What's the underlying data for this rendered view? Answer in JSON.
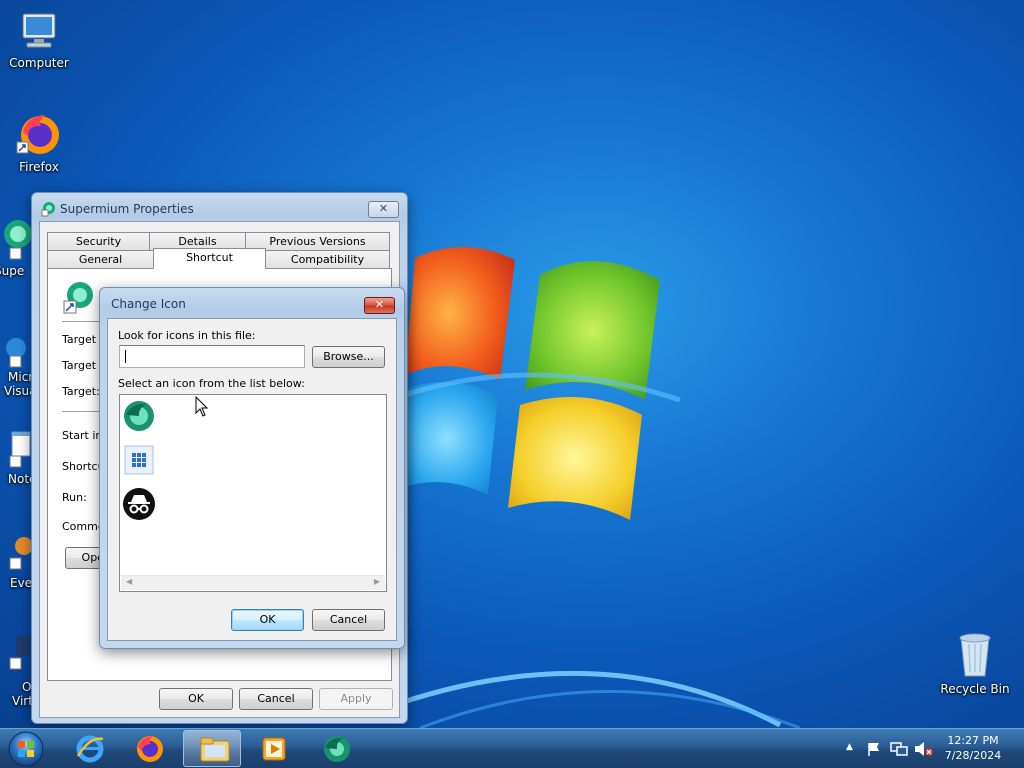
{
  "desktop": {
    "icons": [
      {
        "label": "Computer"
      },
      {
        "label": "Firefox"
      },
      {
        "label": "Supe"
      },
      {
        "label": "Micr"
      },
      {
        "label": "Visua"
      },
      {
        "label": "Note"
      },
      {
        "label": "Eve"
      },
      {
        "label": "O"
      },
      {
        "label": "Virt"
      },
      {
        "label": "Recycle Bin"
      }
    ]
  },
  "properties_window": {
    "title": "Supermium Properties",
    "tabs_top": [
      "Security",
      "Details",
      "Previous Versions"
    ],
    "tabs_bottom": [
      "General",
      "Shortcut",
      "Compatibility"
    ],
    "active_tab": "Shortcut",
    "fields": [
      "Target ty",
      "Target lo",
      "Target:",
      "Start in:",
      "Shortcut",
      "Run:",
      "Commen"
    ],
    "open_button": "Oper",
    "buttons": {
      "ok": "OK",
      "cancel": "Cancel",
      "apply": "Apply"
    }
  },
  "change_icon_dialog": {
    "title": "Change Icon",
    "look_for_label": "Look for icons in this file:",
    "file_value": "",
    "browse_button": "Browse...",
    "select_label": "Select an icon from the list below:",
    "icons": [
      "supermium-icon",
      "app-grid-icon",
      "incognito-icon"
    ],
    "buttons": {
      "ok": "OK",
      "cancel": "Cancel"
    }
  },
  "taskbar": {
    "pinned": [
      "internet-explorer-icon",
      "firefox-icon",
      "file-explorer-icon",
      "media-player-icon",
      "supermium-icon"
    ],
    "clock": {
      "time": "12:27 PM",
      "date": "7/28/2024"
    }
  }
}
